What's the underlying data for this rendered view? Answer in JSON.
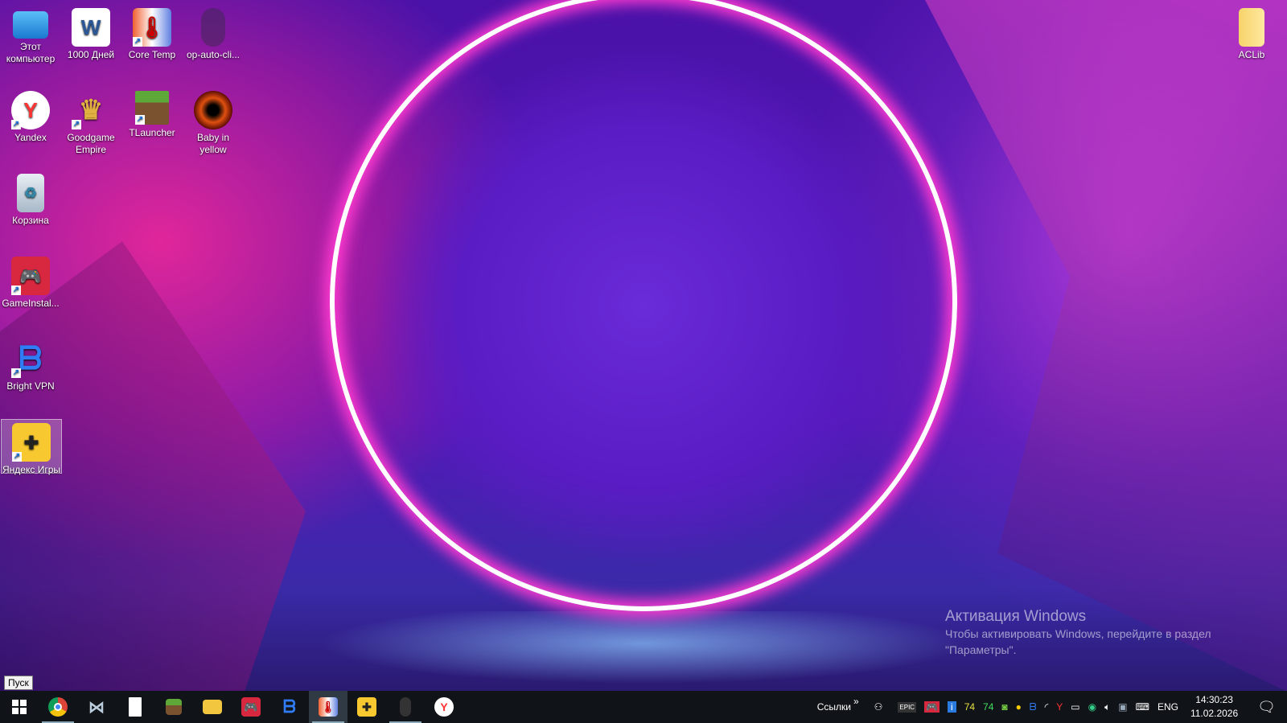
{
  "desktop_icons": [
    {
      "label": "Этот компьютер",
      "icon": "computer-icon"
    },
    {
      "label": "1000 Дней",
      "icon": "word-document-icon"
    },
    {
      "label": "Core Temp",
      "icon": "thermometer-icon"
    },
    {
      "label": "op-auto-cli...",
      "icon": "mouse-icon"
    },
    {
      "label": "Yandex",
      "icon": "yandex-browser-icon"
    },
    {
      "label": "Goodgame Empire",
      "icon": "crown-icon"
    },
    {
      "label": "TLauncher",
      "icon": "minecraft-block-icon"
    },
    {
      "label": "Baby in yellow",
      "icon": "eye-icon"
    },
    {
      "label": "Корзина",
      "icon": "recycle-bin-icon"
    },
    {
      "label": "GameInstal...",
      "icon": "gamepad-icon"
    },
    {
      "label": "Bright VPN",
      "icon": "bright-vpn-icon"
    },
    {
      "label": "Яндекс Игры",
      "icon": "yandex-games-icon"
    },
    {
      "label": "ACLib",
      "icon": "folder-icon"
    }
  ],
  "watermark": {
    "title": "Активация Windows",
    "line1": "Чтобы активировать Windows, перейдите в раздел",
    "line2": "\"Параметры\"."
  },
  "start_tooltip": "Пуск",
  "taskbar": {
    "apps": [
      "Chrome",
      "Visual Studio",
      "Notepad",
      "TLauncher",
      "File Explorer",
      "GameInstaller",
      "Bright VPN",
      "Core Temp",
      "Яндекс Игры",
      "op-auto-clicker",
      "Yandex"
    ],
    "links_label": "Ссылки",
    "links_chevron": "»",
    "tray_temp1": "74",
    "tray_temp2": "74",
    "lang": "ENG",
    "time": "14:30:23",
    "date": "11.02.2026"
  }
}
